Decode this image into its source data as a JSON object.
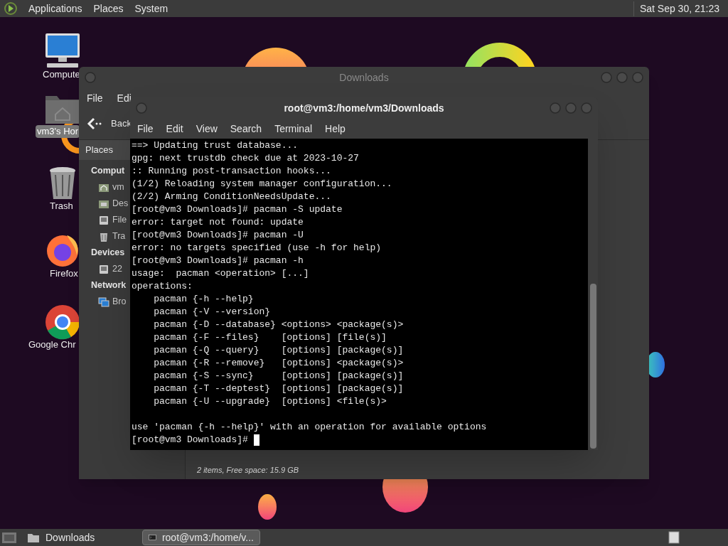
{
  "top_panel": {
    "menus": [
      "Applications",
      "Places",
      "System"
    ],
    "clock": "Sat Sep 30, 21:23"
  },
  "desktop_icons": [
    {
      "kind": "computer",
      "label": "Compute",
      "selected": false
    },
    {
      "kind": "home",
      "label": "vm3's Hor",
      "selected": true
    },
    {
      "kind": "trash",
      "label": "Trash",
      "selected": false
    },
    {
      "kind": "firefox",
      "label": "Firefox",
      "selected": false
    },
    {
      "kind": "chrome",
      "label": "Google Chr",
      "selected": false
    }
  ],
  "file_manager": {
    "title": "Downloads",
    "menu": [
      "File",
      "Edi"
    ],
    "back": "Back",
    "sidebar_header": "Places",
    "sidebar": [
      {
        "kind": "heading",
        "label": "Comput"
      },
      {
        "kind": "home",
        "label": "vm"
      },
      {
        "kind": "folder",
        "label": "Des"
      },
      {
        "kind": "drive",
        "label": "File"
      },
      {
        "kind": "trash",
        "label": "Tra"
      },
      {
        "kind": "heading",
        "label": "Devices"
      },
      {
        "kind": "drive",
        "label": "22"
      },
      {
        "kind": "heading",
        "label": "Network"
      },
      {
        "kind": "network",
        "label": "Bro"
      }
    ],
    "status": "2 items, Free space: 15.9 GB"
  },
  "terminal": {
    "title": "root@vm3:/home/vm3/Downloads",
    "menu": [
      "File",
      "Edit",
      "View",
      "Search",
      "Terminal",
      "Help"
    ],
    "lines": [
      "==> Updating trust database...",
      "gpg: next trustdb check due at 2023-10-27",
      ":: Running post-transaction hooks...",
      "(1/2) Reloading system manager configuration...",
      "(2/2) Arming ConditionNeedsUpdate...",
      "[root@vm3 Downloads]# pacman -S update",
      "error: target not found: update",
      "[root@vm3 Downloads]# pacman -U",
      "error: no targets specified (use -h for help)",
      "[root@vm3 Downloads]# pacman -h",
      "usage:  pacman <operation> [...]",
      "operations:",
      "    pacman {-h --help}",
      "    pacman {-V --version}",
      "    pacman {-D --database} <options> <package(s)>",
      "    pacman {-F --files}    [options] [file(s)]",
      "    pacman {-Q --query}    [options] [package(s)]",
      "    pacman {-R --remove}   [options] <package(s)>",
      "    pacman {-S --sync}     [options] [package(s)]",
      "    pacman {-T --deptest}  [options] [package(s)]",
      "    pacman {-U --upgrade}  [options] <file(s)>"
    ],
    "after_blank": [
      "use 'pacman {-h --help}' with an operation for available options",
      "[root@vm3 Downloads]# "
    ]
  },
  "taskbar": [
    {
      "label": "Downloads",
      "kind": "folder",
      "selected": false
    },
    {
      "label": "root@vm3:/home/v...",
      "kind": "terminal",
      "selected": true
    }
  ]
}
